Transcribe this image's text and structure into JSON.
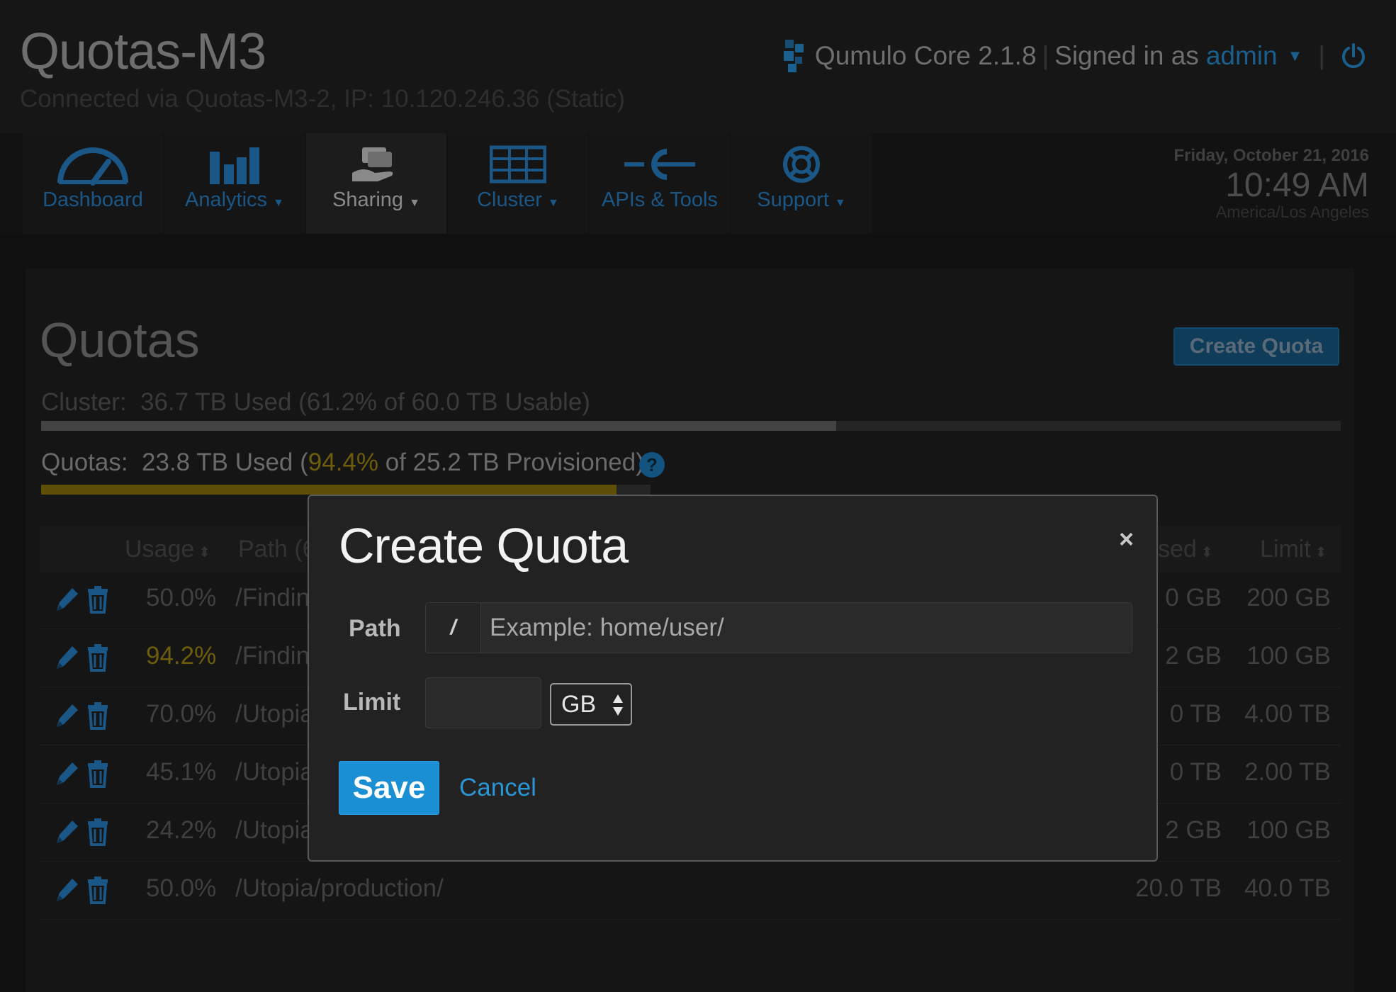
{
  "header": {
    "app_title": "Quotas-M3",
    "connection": "Connected via Quotas-M3-2, IP: 10.120.246.36 (Static)",
    "product": "Qumulo Core 2.1.8",
    "signed_in_label": "Signed in as",
    "user": "admin",
    "logo_icon": "qumulo-logo-icon",
    "power_icon": "power-icon"
  },
  "nav": {
    "items": [
      {
        "label": "Dashboard",
        "icon": "speedometer-icon",
        "dropdown": false,
        "active": false
      },
      {
        "label": "Analytics",
        "icon": "bar-chart-icon",
        "dropdown": true,
        "active": false
      },
      {
        "label": "Sharing",
        "icon": "sharing-hand-icon",
        "dropdown": true,
        "active": true
      },
      {
        "label": "Cluster",
        "icon": "server-rack-icon",
        "dropdown": true,
        "active": false
      },
      {
        "label": "APIs & Tools",
        "icon": "api-plug-icon",
        "dropdown": false,
        "active": false
      },
      {
        "label": "Support",
        "icon": "lifebuoy-icon",
        "dropdown": true,
        "active": false
      }
    ]
  },
  "datetime": {
    "date": "Friday, October 21, 2016",
    "time": "10:49 AM",
    "timezone": "America/Los Angeles"
  },
  "page": {
    "title": "Quotas",
    "create_button": "Create Quota",
    "cluster_label": "Cluster:",
    "cluster_text": "36.7 TB Used (61.2% of 60.0 TB Usable)",
    "cluster_used_fraction": 0.612,
    "quotas_label": "Quotas:",
    "quotas_used": "23.8 TB Used (",
    "quotas_pct": "94.4%",
    "quotas_rest": " of 25.2 TB Provisioned)",
    "quotas_used_fraction": 0.944,
    "help_label": "?"
  },
  "table": {
    "headers": {
      "usage": "Usage",
      "path": "Path (6",
      "used": "sed",
      "limit": "Limit"
    },
    "rows": [
      {
        "usage": "50.0%",
        "path": "/Findin",
        "used": "0 GB",
        "limit": "200 GB",
        "warn": false
      },
      {
        "usage": "94.2%",
        "path": "/Findin",
        "used": "2 GB",
        "limit": "100 GB",
        "warn": true
      },
      {
        "usage": "70.0%",
        "path": "/Utopia",
        "used": "0 TB",
        "limit": "4.00 TB",
        "warn": false
      },
      {
        "usage": "45.1%",
        "path": "/Utopia",
        "used": "0 TB",
        "limit": "2.00 TB",
        "warn": false
      },
      {
        "usage": "24.2%",
        "path": "/Utopia",
        "used": "2 GB",
        "limit": "100 GB",
        "warn": false
      },
      {
        "usage": "50.0%",
        "path": "/Utopia/production/",
        "used": "20.0 TB",
        "limit": "40.0 TB",
        "warn": false
      }
    ]
  },
  "modal": {
    "title": "Create Quota",
    "close": "×",
    "path_label": "Path",
    "path_prefix": "/",
    "path_value": "",
    "path_placeholder": "Example: home/user/",
    "limit_label": "Limit",
    "limit_value": "",
    "unit": "GB",
    "save": "Save",
    "cancel": "Cancel"
  },
  "colors": {
    "accent": "#1a8fd3",
    "warning": "#6e5d0c",
    "dimmed_link": "#1b5786"
  }
}
